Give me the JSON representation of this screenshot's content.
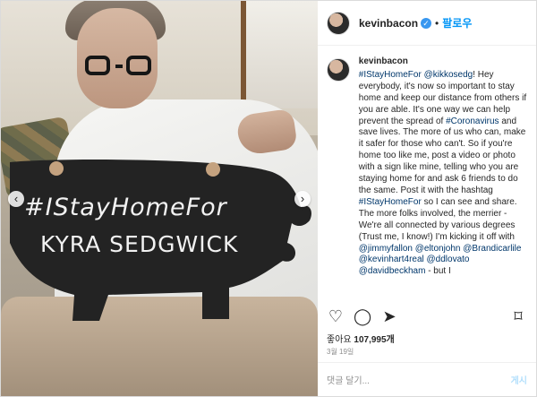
{
  "header": {
    "username": "kevinbacon",
    "verified_badge": "✓",
    "dot": "•",
    "follow_label": "팔로우"
  },
  "media": {
    "sign_line1": "#IStayHomeFor",
    "sign_line2": "KYRA SEDGWICK",
    "prev_arrow": "‹",
    "next_arrow": "›"
  },
  "caption": {
    "username": "kevinbacon",
    "parts": [
      {
        "text": "#IStayHomeFor",
        "type": "tag"
      },
      {
        "text": " ",
        "type": "text"
      },
      {
        "text": "@kikkosedg",
        "type": "tag"
      },
      {
        "text": "! Hey everybody, it's now so important to stay home and keep our distance from others if you are able. It's one way we can help prevent the spread of ",
        "type": "text"
      },
      {
        "text": "#Coronavirus",
        "type": "tag"
      },
      {
        "text": " and save lives. The more of us who can, make it safer for those who can't. So if you're home too like me, post a video or photo with a sign like mine, telling who you are staying home for and ask 6 friends to do the same. Post it with the hashtag ",
        "type": "text"
      },
      {
        "text": "#IStayHomeFor",
        "type": "tag"
      },
      {
        "text": " so I can see and share. The more folks involved, the merrier - We're all connected by various degrees (Trust me, I know!) I'm kicking it off with ",
        "type": "text"
      },
      {
        "text": "@jimmyfallon",
        "type": "tag"
      },
      {
        "text": " ",
        "type": "text"
      },
      {
        "text": "@eltonjohn",
        "type": "tag"
      },
      {
        "text": " ",
        "type": "text"
      },
      {
        "text": "@Brandicarlile",
        "type": "tag"
      },
      {
        "text": " ",
        "type": "text"
      },
      {
        "text": "@kevinhart4real",
        "type": "tag"
      },
      {
        "text": " ",
        "type": "text"
      },
      {
        "text": "@ddlovato",
        "type": "tag"
      },
      {
        "text": " ",
        "type": "text"
      },
      {
        "text": "@davidbeckham",
        "type": "tag"
      },
      {
        "text": " - but I",
        "type": "text"
      }
    ]
  },
  "actions": {
    "heart_icon": "♡",
    "comment_icon": "◯",
    "share_icon": "➤",
    "save_icon": "⌑"
  },
  "likes": {
    "prefix": "좋아요",
    "count": "107,995개"
  },
  "date": "3월 19일",
  "footer": {
    "comment_placeholder": "댓글 달기...",
    "post_label": "게시"
  }
}
